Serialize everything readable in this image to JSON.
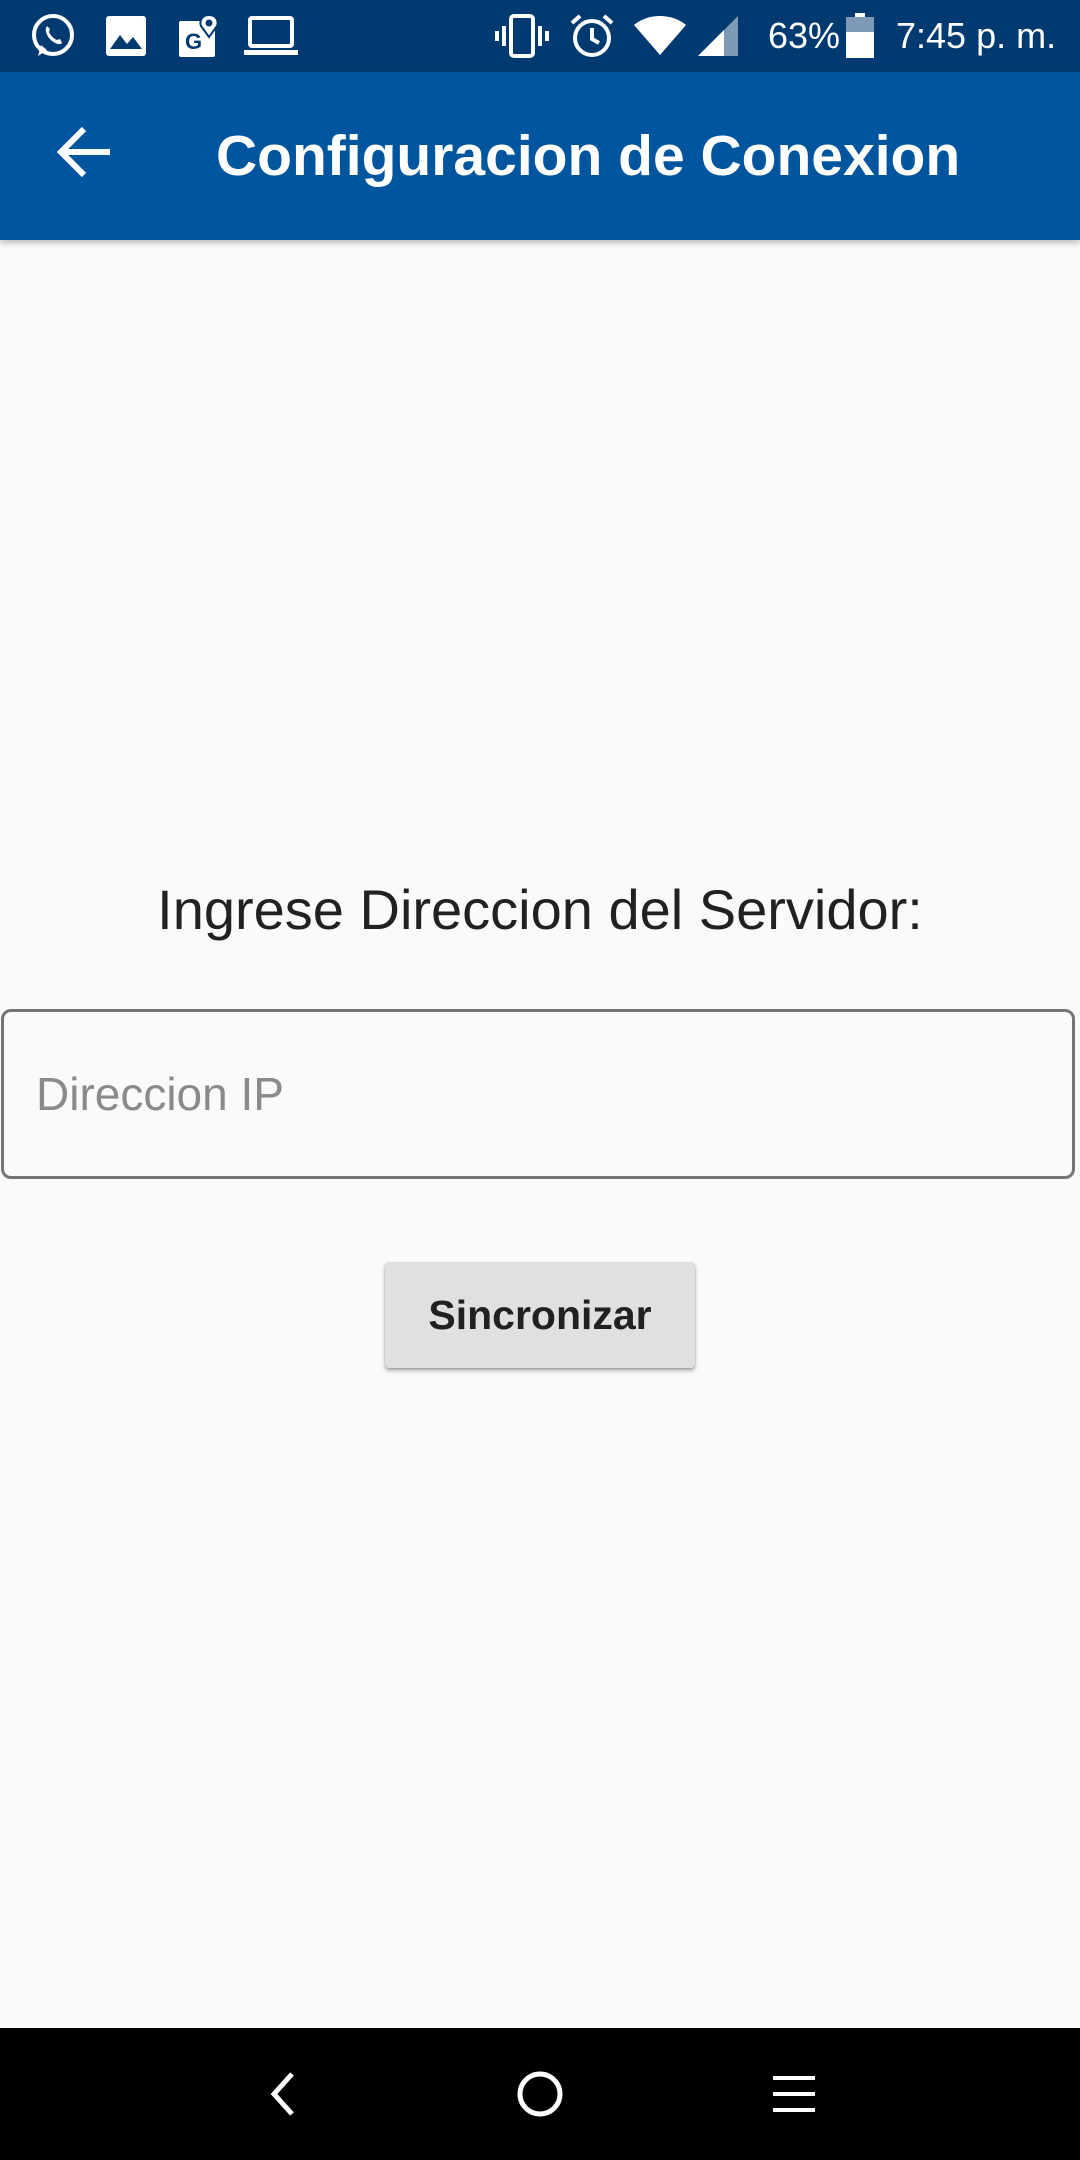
{
  "status_bar": {
    "battery_percent": "63%",
    "time": "7:45 p. m.",
    "left_icons": [
      "whatsapp-icon",
      "gallery-icon",
      "maps-icon",
      "laptop-icon"
    ],
    "right_icons": [
      "vibrate-icon",
      "alarm-icon",
      "wifi-icon",
      "cell-signal-icon",
      "battery-icon"
    ],
    "background_color": "#003a70"
  },
  "app_bar": {
    "title": "Configuracion de Conexion",
    "back_icon": "arrow-back-icon",
    "background_color": "#00569e"
  },
  "form": {
    "prompt": "Ingrese Direccion del Servidor:",
    "ip_placeholder": "Direccion IP",
    "ip_value": "",
    "submit_label": "Sincronizar"
  },
  "nav_bar": {
    "buttons": [
      "nav-back-icon",
      "nav-home-icon",
      "nav-menu-icon"
    ],
    "background_color": "#000000"
  }
}
